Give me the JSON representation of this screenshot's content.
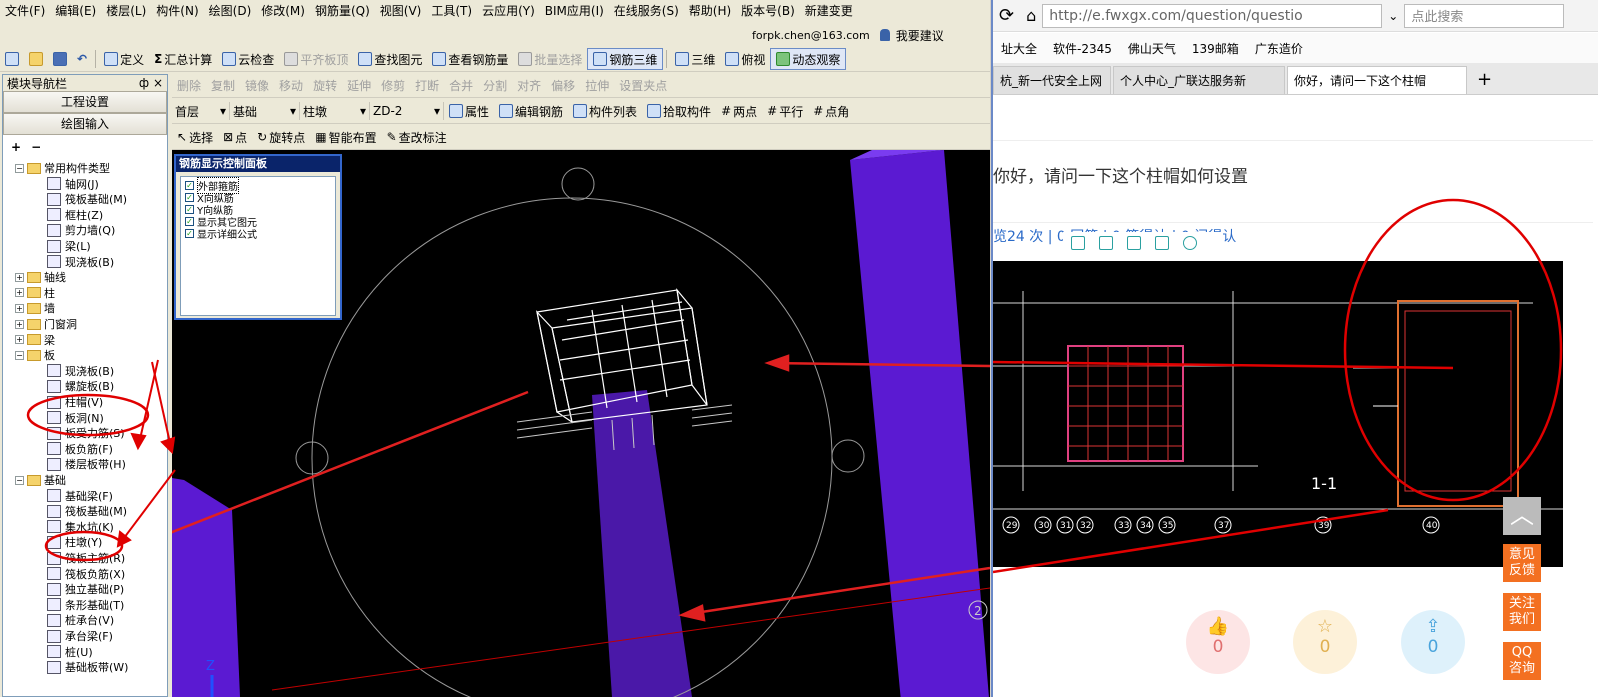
{
  "menu": [
    "文件(F)",
    "编辑(E)",
    "楼层(L)",
    "构件(N)",
    "绘图(D)",
    "修改(M)",
    "钢筋量(Q)",
    "视图(V)",
    "工具(T)",
    "云应用(Y)",
    "BIM应用(I)",
    "在线服务(S)",
    "帮助(H)",
    "版本号(B)",
    "新建变更"
  ],
  "account": {
    "email": "forpk.chen@163.com",
    "suggest": "我要建议"
  },
  "toolbar1": [
    "定义",
    "汇总计算",
    "云检查",
    "平齐板顶",
    "查找图元",
    "查看钢筋量",
    "批量选择",
    "钢筋三维",
    "三维",
    "俯视",
    "动态观察"
  ],
  "toolbar2": [
    "删除",
    "复制",
    "镜像",
    "移动",
    "旋转",
    "延伸",
    "修剪",
    "打断",
    "合并",
    "分割",
    "对齐",
    "偏移",
    "拉伸",
    "设置夹点"
  ],
  "toolbar3": {
    "floor": "首层",
    "category": "基础",
    "type": "柱墩",
    "item": "ZD-2",
    "buttons": [
      "属性",
      "编辑钢筋",
      "构件列表",
      "拾取构件",
      "两点",
      "平行",
      "点角"
    ]
  },
  "toolbar4": [
    "选择",
    "点",
    "旋转点",
    "智能布置",
    "查改标注"
  ],
  "nav": {
    "title": "模块导航栏",
    "pin": "ф",
    "close": "×",
    "pane1": "工程设置",
    "pane2": "绘图输入",
    "items": [
      {
        "label": "常用构件类型",
        "level": 0,
        "folder": true,
        "exp": "−"
      },
      {
        "label": "轴网(J)",
        "level": 1
      },
      {
        "label": "筏板基础(M)",
        "level": 1
      },
      {
        "label": "框柱(Z)",
        "level": 1
      },
      {
        "label": "剪力墙(Q)",
        "level": 1
      },
      {
        "label": "梁(L)",
        "level": 1
      },
      {
        "label": "现浇板(B)",
        "level": 1
      },
      {
        "label": "轴线",
        "level": 0,
        "folder": true,
        "exp": "+"
      },
      {
        "label": "柱",
        "level": 0,
        "folder": true,
        "exp": "+"
      },
      {
        "label": "墙",
        "level": 0,
        "folder": true,
        "exp": "+"
      },
      {
        "label": "门窗洞",
        "level": 0,
        "folder": true,
        "exp": "+"
      },
      {
        "label": "梁",
        "level": 0,
        "folder": true,
        "exp": "+"
      },
      {
        "label": "板",
        "level": 0,
        "folder": true,
        "exp": "−"
      },
      {
        "label": "现浇板(B)",
        "level": 1
      },
      {
        "label": "螺旋板(B)",
        "level": 1
      },
      {
        "label": "柱帽(V)",
        "level": 1
      },
      {
        "label": "板洞(N)",
        "level": 1
      },
      {
        "label": "板受力筋(S)",
        "level": 1
      },
      {
        "label": "板负筋(F)",
        "level": 1
      },
      {
        "label": "楼层板带(H)",
        "level": 1
      },
      {
        "label": "基础",
        "level": 0,
        "folder": true,
        "exp": "−"
      },
      {
        "label": "基础梁(F)",
        "level": 1
      },
      {
        "label": "筏板基础(M)",
        "level": 1
      },
      {
        "label": "集水坑(K)",
        "level": 1
      },
      {
        "label": "柱墩(Y)",
        "level": 1
      },
      {
        "label": "筏板主筋(R)",
        "level": 1
      },
      {
        "label": "筏板负筋(X)",
        "level": 1
      },
      {
        "label": "独立基础(P)",
        "level": 1
      },
      {
        "label": "条形基础(T)",
        "level": 1
      },
      {
        "label": "桩承台(V)",
        "level": 1
      },
      {
        "label": "承台梁(F)",
        "level": 1
      },
      {
        "label": "桩(U)",
        "level": 1
      },
      {
        "label": "基础板带(W)",
        "level": 1
      }
    ]
  },
  "panel": {
    "title": "钢筋显示控制面板",
    "options": [
      "外部箍筋",
      "X向纵筋",
      "Y向纵筋",
      "显示其它图元",
      "显示详细公式"
    ]
  },
  "viewport": {
    "axis_z": "Z",
    "corner": "2"
  },
  "browser": {
    "url": "http://e.fwxgx.com/question/questio",
    "search_placeholder": "点此搜索",
    "bookmarks": [
      "址大全",
      "软件-2345",
      "佛山天气",
      "139邮箱",
      "广东造价"
    ],
    "tabs": [
      "杭_新一代安全上网",
      "个人中心_广联达服务新",
      "你好，请问一下这个柱帽"
    ],
    "question": "你好，请问一下这个柱帽如何设置",
    "stats": "览24 次 | 0 回答 | 0 筐得认 | 0 问得认",
    "drawing_label": "1-1",
    "axis_numbers": [
      "29",
      "30",
      "31",
      "32",
      "33",
      "34",
      "35",
      "37",
      "39",
      "40"
    ],
    "side_buttons": [
      "意见\n反馈",
      "关注\n我们",
      "QQ\n咨询"
    ],
    "counts": [
      "0",
      "0",
      "0"
    ]
  }
}
